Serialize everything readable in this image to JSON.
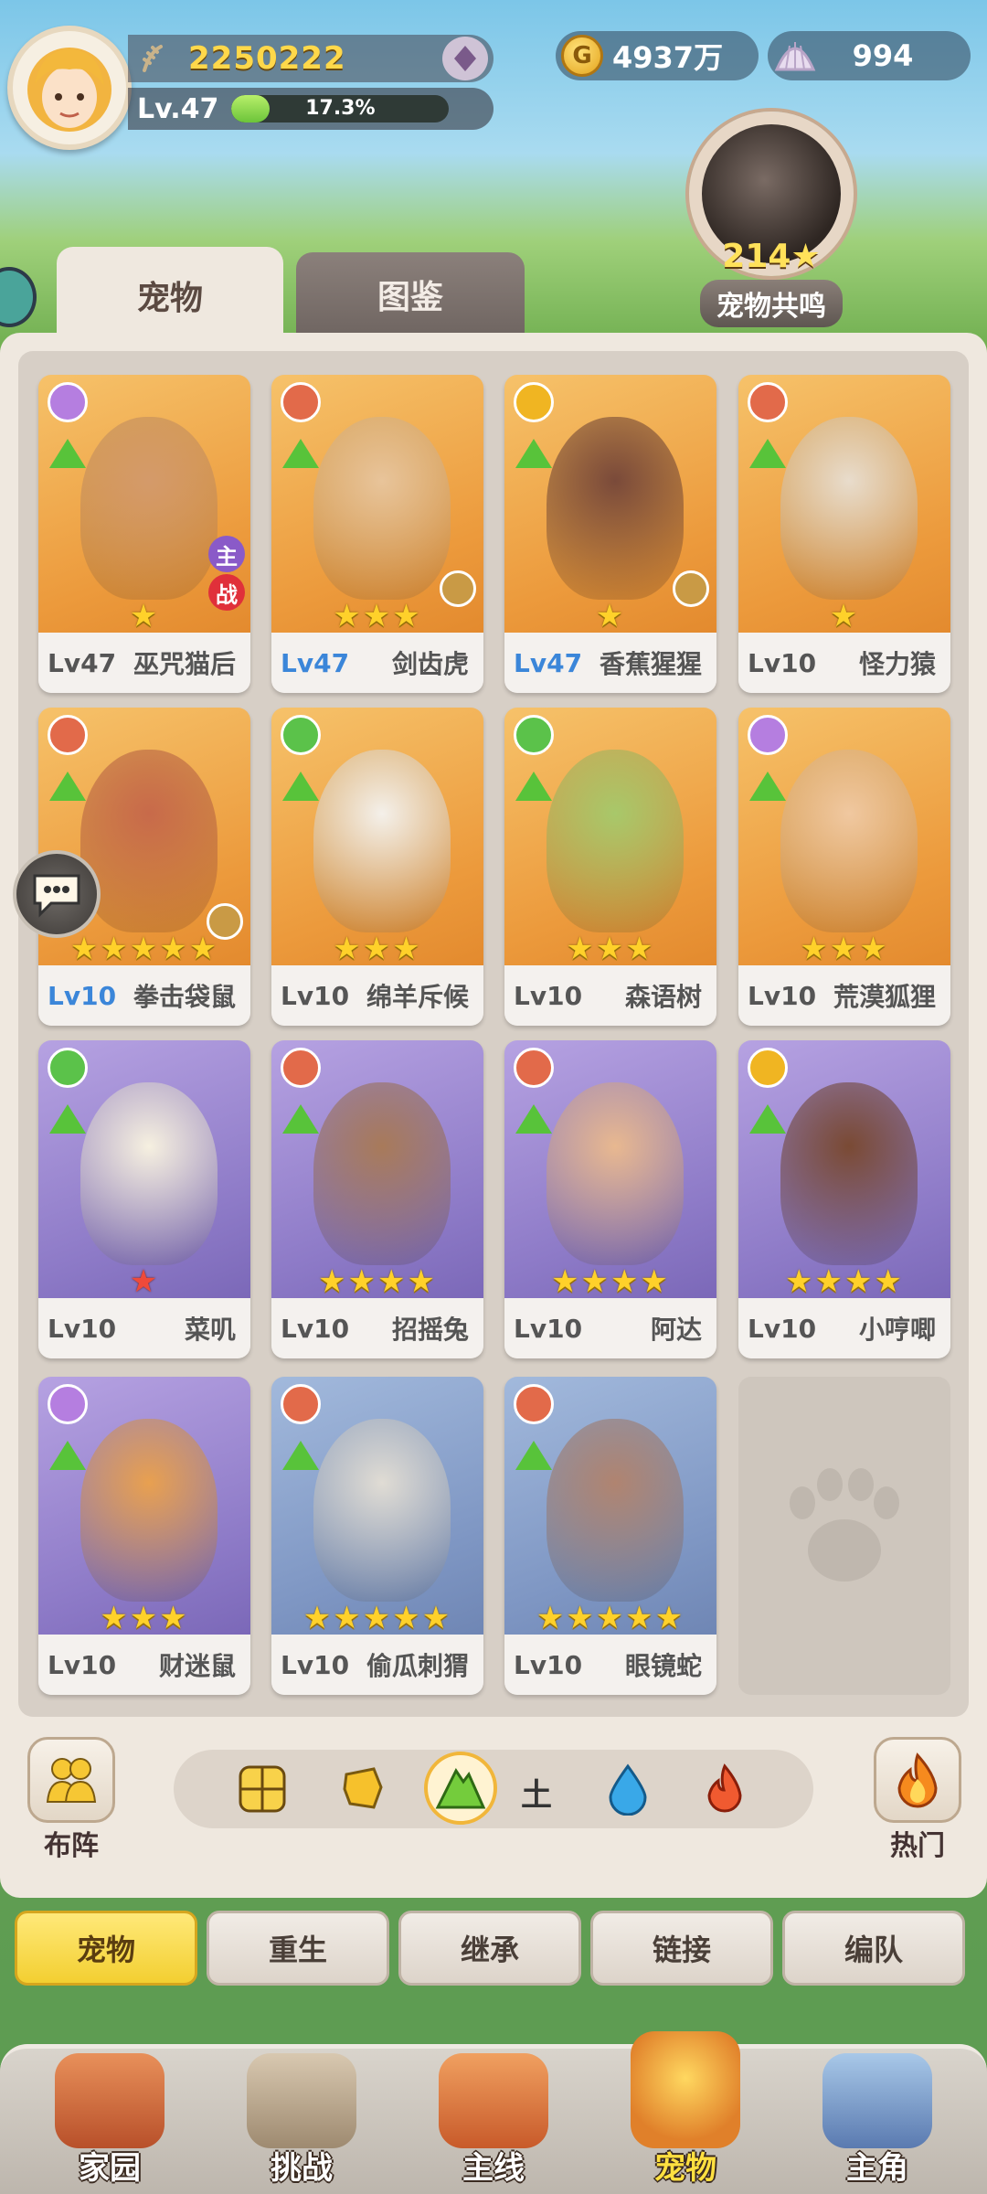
{
  "hud": {
    "power": "2250222",
    "level": "Lv.47",
    "exp_percent": 17.3,
    "exp_text": "17.3%",
    "coins": "4937万",
    "shells": "994",
    "coin_glyph": "G"
  },
  "resonance": {
    "count": "214★",
    "label": "宠物共鸣"
  },
  "tabs": {
    "pets": "宠物",
    "codex": "图鉴"
  },
  "pets": [
    {
      "level": "Lv47",
      "name": "巫咒猫后",
      "stars": "★",
      "bg": "orange",
      "type_color": "#b57ee0",
      "level_blue": false,
      "star_red": false,
      "main_battle": true,
      "gear": false
    },
    {
      "level": "Lv47",
      "name": "剑齿虎",
      "stars": "★★★",
      "bg": "orange",
      "type_color": "#e26a4a",
      "level_blue": true,
      "star_red": false,
      "main_battle": false,
      "gear": true
    },
    {
      "level": "Lv47",
      "name": "香蕉猩猩",
      "stars": "★",
      "bg": "orange",
      "type_color": "#f0b522",
      "level_blue": true,
      "star_red": false,
      "main_battle": false,
      "gear": true
    },
    {
      "level": "Lv10",
      "name": "怪力猿",
      "stars": "★",
      "bg": "orange",
      "type_color": "#e26a4a",
      "level_blue": false,
      "star_red": false,
      "main_battle": false,
      "gear": false
    },
    {
      "level": "Lv10",
      "name": "拳击袋鼠",
      "stars": "★★★★★",
      "bg": "orange",
      "type_color": "#e26a4a",
      "level_blue": true,
      "star_red": false,
      "main_battle": false,
      "gear": true
    },
    {
      "level": "Lv10",
      "name": "绵羊斥候",
      "stars": "★★★",
      "bg": "orange",
      "type_color": "#5bc24a",
      "level_blue": false,
      "star_red": false,
      "main_battle": false,
      "gear": false
    },
    {
      "level": "Lv10",
      "name": "森语树",
      "stars": "★★★",
      "bg": "orange",
      "type_color": "#5bc24a",
      "level_blue": false,
      "star_red": false,
      "main_battle": false,
      "gear": false
    },
    {
      "level": "Lv10",
      "name": "荒漠狐狸",
      "stars": "★★★",
      "bg": "orange",
      "type_color": "#b57ee0",
      "level_blue": false,
      "star_red": false,
      "main_battle": false,
      "gear": false
    },
    {
      "level": "Lv10",
      "name": "菜叽",
      "stars": "★",
      "bg": "purple",
      "type_color": "#5bc24a",
      "level_blue": false,
      "star_red": true,
      "main_battle": false,
      "gear": false
    },
    {
      "level": "Lv10",
      "name": "招摇兔",
      "stars": "★★★★",
      "bg": "purple",
      "type_color": "#e26a4a",
      "level_blue": false,
      "star_red": false,
      "main_battle": false,
      "gear": false
    },
    {
      "level": "Lv10",
      "name": "阿达",
      "stars": "★★★★",
      "bg": "purple",
      "type_color": "#e26a4a",
      "level_blue": false,
      "star_red": false,
      "main_battle": false,
      "gear": false
    },
    {
      "level": "Lv10",
      "name": "小哼唧",
      "stars": "★★★★",
      "bg": "purple",
      "type_color": "#f0b522",
      "level_blue": false,
      "star_red": false,
      "main_battle": false,
      "gear": false
    },
    {
      "level": "Lv10",
      "name": "财迷鼠",
      "stars": "★★★",
      "bg": "purple",
      "type_color": "#b57ee0",
      "level_blue": false,
      "star_red": false,
      "main_battle": false,
      "gear": false
    },
    {
      "level": "Lv10",
      "name": "偷瓜刺猬",
      "stars": "★★★★★",
      "bg": "blue",
      "type_color": "#e26a4a",
      "level_blue": false,
      "star_red": false,
      "main_battle": false,
      "gear": false
    },
    {
      "level": "Lv10",
      "name": "眼镜蛇",
      "stars": "★★★★★",
      "bg": "blue",
      "type_color": "#e26a4a",
      "level_blue": false,
      "star_red": false,
      "main_battle": false,
      "gear": false
    }
  ],
  "main_badge": {
    "top": "主",
    "bottom": "战"
  },
  "filter": {
    "formation_label": "布阵",
    "hot_label": "热门",
    "element_label": "土"
  },
  "actions": [
    "宠物",
    "重生",
    "继承",
    "链接",
    "编队"
  ],
  "nav": [
    "家园",
    "挑战",
    "主线",
    "宠物",
    "主角"
  ]
}
